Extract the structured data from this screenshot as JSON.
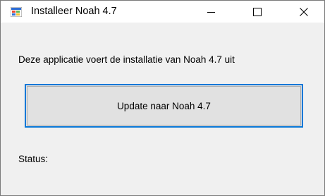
{
  "window": {
    "title": "Installeer Noah 4.7",
    "icon": "windows-app-icon",
    "controls": {
      "minimize_icon": "minimize-icon",
      "maximize_icon": "maximize-icon",
      "close_icon": "close-icon"
    }
  },
  "main": {
    "message": "Deze applicatie voert de installatie van Noah 4.7 uit",
    "update_button_label": "Update naar Noah 4.7",
    "status_label": "Status:"
  },
  "colors": {
    "window_background": "#f0f0f0",
    "titlebar_background": "#ffffff",
    "button_focus_border": "#0a78d7",
    "button_background": "#e1e1e1"
  }
}
